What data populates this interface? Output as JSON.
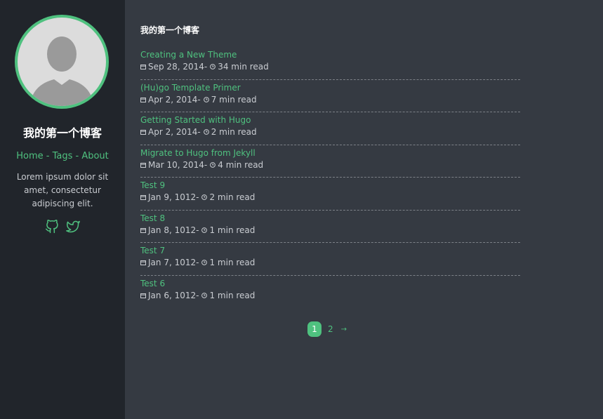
{
  "sidebar": {
    "blog_title": "我的第一个博客",
    "nav": {
      "home": "Home",
      "sep1": " - ",
      "tags": "Tags",
      "sep2": " - ",
      "about": "About"
    },
    "description": "Lorem ipsum dolor sit amet, consectetur adipiscing elit.",
    "social": [
      "github-icon",
      "twitter-icon"
    ]
  },
  "main": {
    "title": "我的第一个博客",
    "posts": [
      {
        "title": "Creating a New Theme",
        "date": "Sep 28, 2014",
        "sep": " - ",
        "read": "34 min read"
      },
      {
        "title": "(Hu)go Template Primer",
        "date": "Apr 2, 2014",
        "sep": " - ",
        "read": "7 min read"
      },
      {
        "title": "Getting Started with Hugo",
        "date": "Apr 2, 2014",
        "sep": " - ",
        "read": "2 min read"
      },
      {
        "title": "Migrate to Hugo from Jekyll",
        "date": "Mar 10, 2014",
        "sep": " - ",
        "read": "4 min read"
      },
      {
        "title": "Test 9",
        "date": "Jan 9, 1012",
        "sep": " - ",
        "read": "2 min read"
      },
      {
        "title": "Test 8",
        "date": "Jan 8, 1012",
        "sep": " - ",
        "read": "1 min read"
      },
      {
        "title": "Test 7",
        "date": "Jan 7, 1012",
        "sep": " - ",
        "read": "1 min read"
      },
      {
        "title": "Test 6",
        "date": "Jan 6, 1012",
        "sep": " - ",
        "read": "1 min read"
      }
    ]
  },
  "pagination": {
    "current": "1",
    "next_page": "2",
    "next_arrow": "→"
  },
  "colors": {
    "accent": "#4fc17f",
    "sidebar_bg": "#21252b",
    "main_bg": "#353a42"
  }
}
